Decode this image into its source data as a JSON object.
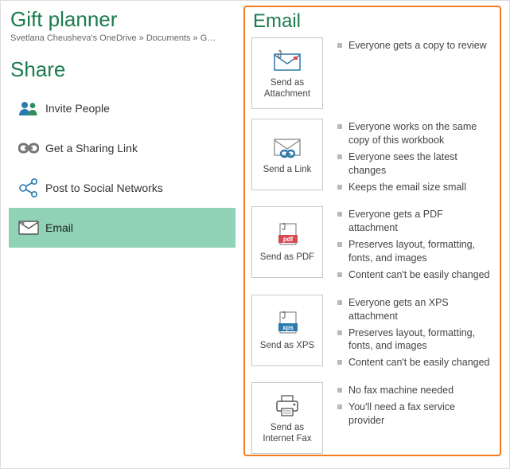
{
  "doc_title": "Gift planner",
  "breadcrumbs": "Svetlana Cheusheva's OneDrive » Documents » G…",
  "share_title": "Share",
  "share_items": [
    {
      "label": "Invite People"
    },
    {
      "label": "Get a Sharing Link"
    },
    {
      "label": "Post to Social Networks"
    },
    {
      "label": "Email"
    }
  ],
  "panel_title": "Email",
  "options": [
    {
      "label": "Send as Attachment",
      "bullets": [
        "Everyone gets a copy to review"
      ]
    },
    {
      "label": "Send a Link",
      "bullets": [
        "Everyone works on the same copy of this workbook",
        "Everyone sees the latest changes",
        "Keeps the email size small"
      ]
    },
    {
      "label": "Send as PDF",
      "bullets": [
        "Everyone gets a PDF attachment",
        "Preserves layout, formatting, fonts, and images",
        "Content can't be easily changed"
      ]
    },
    {
      "label": "Send as XPS",
      "bullets": [
        "Everyone gets an XPS attachment",
        "Preserves layout, formatting, fonts, and images",
        "Content can't be easily changed"
      ]
    },
    {
      "label": "Send as Internet Fax",
      "bullets": [
        "No fax machine needed",
        "You'll need a fax service provider"
      ]
    }
  ]
}
